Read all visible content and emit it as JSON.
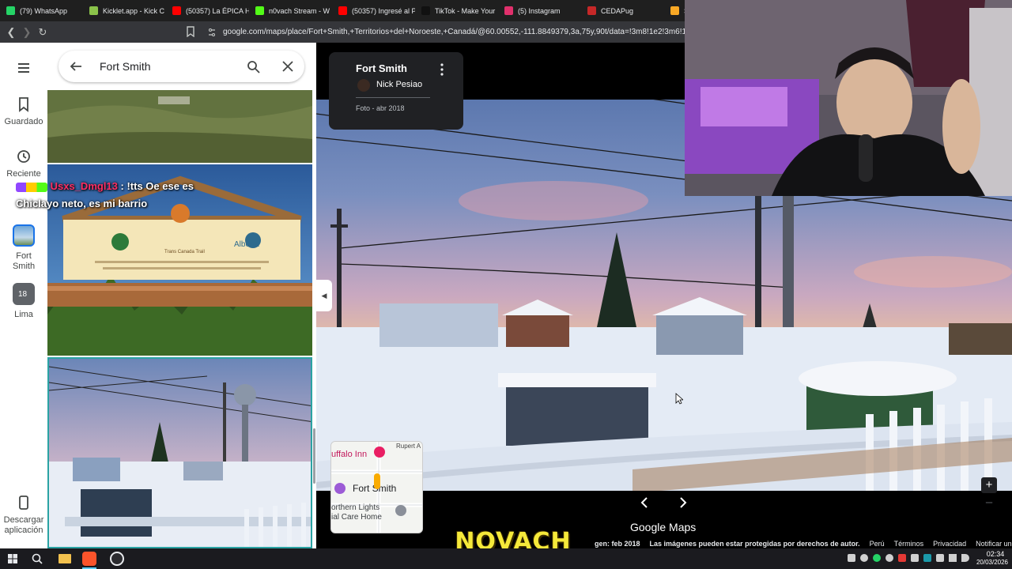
{
  "browser": {
    "tabs": [
      {
        "label": "(79) WhatsApp",
        "color": "#25d366"
      },
      {
        "label": "Kicklet.app - Kick C",
        "color": "#8bc34a"
      },
      {
        "label": "(50357) La ÉPICA H",
        "color": "#ff0000"
      },
      {
        "label": "n0vach Stream - W",
        "color": "#53fc18"
      },
      {
        "label": "(50357) Ingresé al P",
        "color": "#ff0000"
      },
      {
        "label": "TikTok - Make Your",
        "color": "#111111"
      },
      {
        "label": "(5) Instagram",
        "color": "#e1306c"
      },
      {
        "label": "CEDAPug",
        "color": "#c62828"
      },
      {
        "label": "Set",
        "color": "#f9a825"
      }
    ],
    "url": "google.com/maps/place/Fort+Smith,+Territorios+del+Noroeste,+Canadá/@60.00552,-111.8849379,3a,75y,90t/data=!3m8!1e2!3m6!1sCI..."
  },
  "rail": {
    "saved_label": "Guardado",
    "recent_label": "Reciente",
    "fort_smith_label": "Fort\nSmith",
    "lima_label": "Lima",
    "lima_badge": "18",
    "download_label": "Descargar\naplicación"
  },
  "panel": {
    "search_value": "Fort Smith"
  },
  "chat": {
    "username": "Usxs_Dmgl13",
    "message_line1": " : !tts Oe ese es",
    "message_line2": "Chiclayo neto, es mi barrio"
  },
  "sign": {
    "sign_top": "Trans Canada Trail",
    "alberta": "Alberta"
  },
  "viewer": {
    "place_title": "Fort Smith",
    "author": "Nick Pesiao",
    "photo_date": "Foto - abr 2018",
    "brand": "Google Maps",
    "capture_date": "gen: feb 2018",
    "copyright": "Las imágenes pueden estar protegidas por derechos de autor.",
    "links": [
      "Perú",
      "Términos",
      "Privacidad",
      "Notificar un problema"
    ]
  },
  "minimap": {
    "label1": "uffalo Inn",
    "label2": "Fort Smith",
    "label3": "orthern Lights",
    "label4": "ial Care Home",
    "label5": "Rupert A"
  },
  "overlay": {
    "logo_text": "NOVACH"
  },
  "taskbar": {
    "time": "02:34",
    "date": "20/03/2026"
  }
}
